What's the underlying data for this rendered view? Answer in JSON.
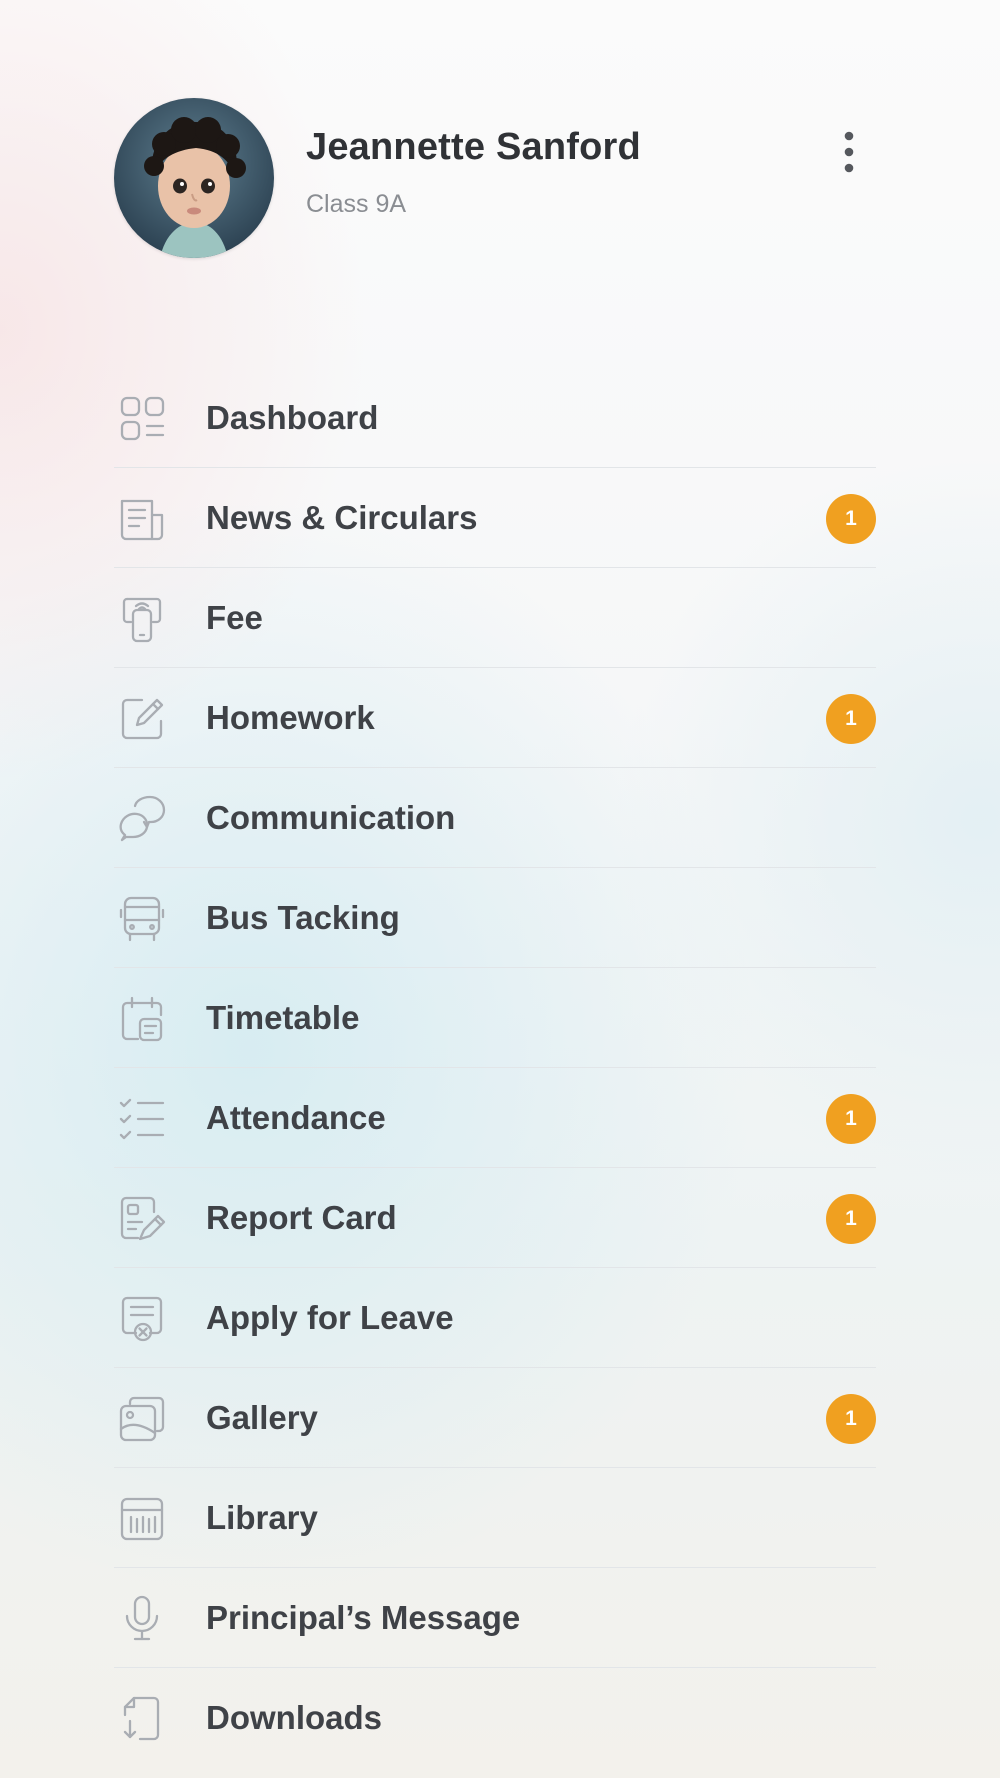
{
  "profile": {
    "name": "Jeannette Sanford",
    "class_label": "Class 9A",
    "avatar_icon": "child-portrait-avatar",
    "more_icon": "kebab-menu-icon"
  },
  "colors": {
    "badge": "#f0a020",
    "label": "#3f4247",
    "icon": "#a9adb3",
    "divider": "#e2e5e8"
  },
  "menu": {
    "items": [
      {
        "label": "Dashboard",
        "icon": "dashboard-icon",
        "badge": null
      },
      {
        "label": "News & Circulars",
        "icon": "newspaper-icon",
        "badge": "1"
      },
      {
        "label": "Fee",
        "icon": "payment-phone-icon",
        "badge": null
      },
      {
        "label": "Homework",
        "icon": "edit-note-icon",
        "badge": "1"
      },
      {
        "label": "Communication",
        "icon": "chat-bubbles-icon",
        "badge": null
      },
      {
        "label": "Bus Tacking",
        "icon": "bus-icon",
        "badge": null
      },
      {
        "label": "Timetable",
        "icon": "calendar-icon",
        "badge": null
      },
      {
        "label": "Attendance",
        "icon": "checklist-icon",
        "badge": "1"
      },
      {
        "label": "Report Card",
        "icon": "report-card-icon",
        "badge": "1"
      },
      {
        "label": "Apply for Leave",
        "icon": "leave-form-icon",
        "badge": null
      },
      {
        "label": "Gallery",
        "icon": "gallery-icon",
        "badge": "1"
      },
      {
        "label": "Library",
        "icon": "library-icon",
        "badge": null
      },
      {
        "label": "Principal’s Message",
        "icon": "microphone-icon",
        "badge": null
      },
      {
        "label": "Downloads",
        "icon": "download-file-icon",
        "badge": null
      }
    ]
  }
}
